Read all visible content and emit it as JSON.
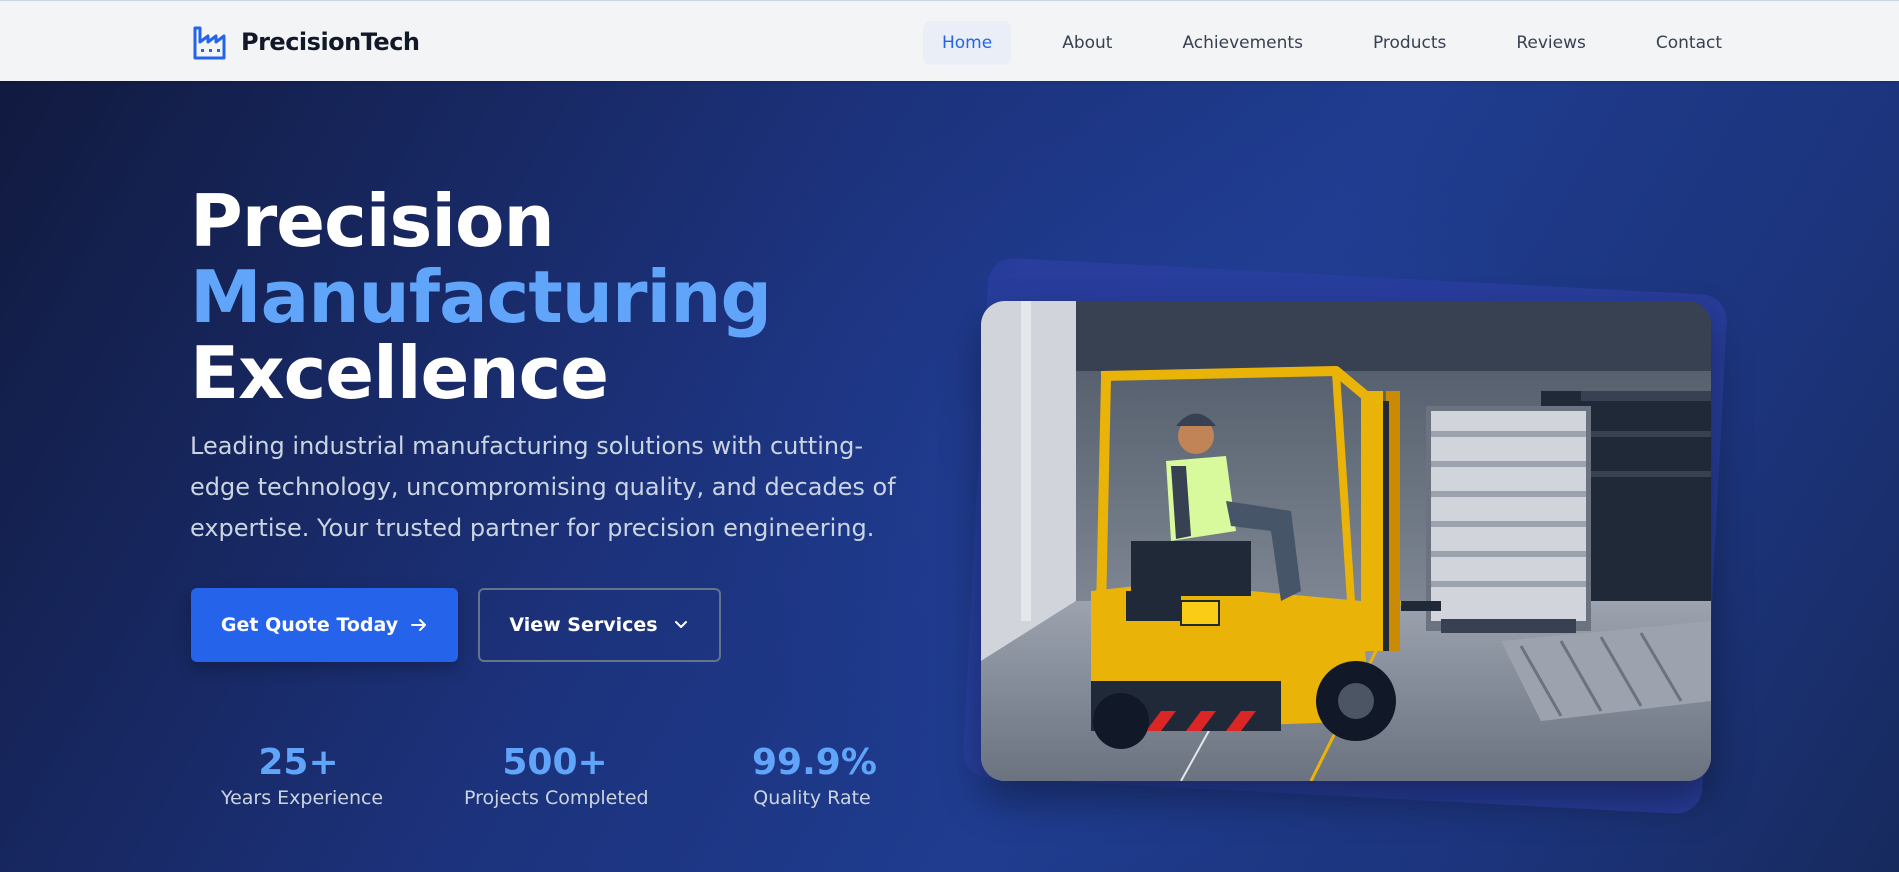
{
  "brand": {
    "name": "PrecisionTech",
    "icon": "factory-icon",
    "accent_color": "#2563eb"
  },
  "nav": {
    "items": [
      {
        "label": "Home",
        "active": true
      },
      {
        "label": "About",
        "active": false
      },
      {
        "label": "Achievements",
        "active": false
      },
      {
        "label": "Products",
        "active": false
      },
      {
        "label": "Reviews",
        "active": false
      },
      {
        "label": "Contact",
        "active": false
      }
    ]
  },
  "hero": {
    "title_line1": "Precision",
    "title_line2": "Manufacturing",
    "title_line3": "Excellence",
    "subtitle": "Leading industrial manufacturing solutions with cutting-edge technology, uncompromising quality, and decades of expertise. Your trusted partner for precision engineering.",
    "primary_button": {
      "label": "Get Quote Today",
      "icon": "arrow-right-icon"
    },
    "secondary_button": {
      "label": "View Services",
      "icon": "chevron-down-icon"
    },
    "stats": [
      {
        "value": "25+",
        "label": "Years Experience"
      },
      {
        "value": "500+",
        "label": "Projects Completed"
      },
      {
        "value": "99.9%",
        "label": "Quality Rate"
      }
    ],
    "image": {
      "icon": "forklift-warehouse-photo"
    },
    "colors": {
      "title": "#ffffff",
      "title_accent": "#60a5fa",
      "stat_value": "#60a5fa",
      "text_muted": "#cbd5e1",
      "background": "#1e3a8a"
    }
  }
}
